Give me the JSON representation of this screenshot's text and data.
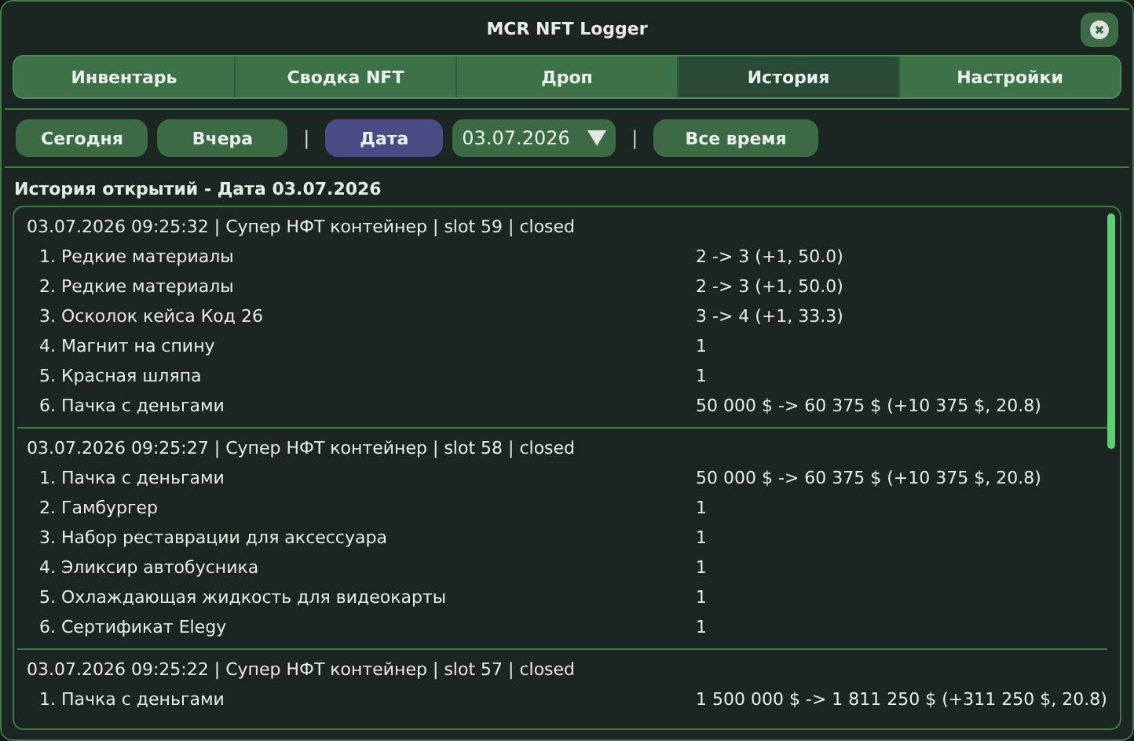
{
  "window": {
    "title": "MCR NFT Logger"
  },
  "tabs": [
    {
      "label": "Инвентарь",
      "selected": false
    },
    {
      "label": "Сводка NFT",
      "selected": false
    },
    {
      "label": "Дроп",
      "selected": false
    },
    {
      "label": "История",
      "selected": true
    },
    {
      "label": "Настройки",
      "selected": false
    }
  ],
  "filters": [
    {
      "kind": "button",
      "label": "Сегодня",
      "selected": false
    },
    {
      "kind": "button",
      "label": "Вчера",
      "selected": false
    },
    {
      "kind": "separator",
      "label": "|"
    },
    {
      "kind": "button",
      "label": "Дата",
      "selected": true
    },
    {
      "kind": "date",
      "value": "03.07.2026"
    },
    {
      "kind": "separator",
      "label": "|"
    },
    {
      "kind": "button",
      "label": "Все время",
      "selected": false
    }
  ],
  "history": {
    "heading": "История открытий - Дата 03.07.2026",
    "entries": [
      {
        "header": "03.07.2026 09:25:32 | Супер НФТ контейнер | slot 59 | closed",
        "items": [
          {
            "name": "1. Редкие материалы",
            "value": "2 -> 3 (+1, 50.0)"
          },
          {
            "name": "2. Редкие материалы",
            "value": "2 -> 3 (+1, 50.0)"
          },
          {
            "name": "3. Осколок кейса Код 26",
            "value": "3 -> 4 (+1, 33.3)"
          },
          {
            "name": "4. Магнит на спину",
            "value": "1"
          },
          {
            "name": "5. Красная шляпа",
            "value": "1"
          },
          {
            "name": "6. Пачка с деньгами",
            "value": "50 000 $ -> 60 375 $ (+10 375 $, 20.8)"
          }
        ]
      },
      {
        "header": "03.07.2026 09:25:27 | Супер НФТ контейнер | slot 58 | closed",
        "items": [
          {
            "name": "1. Пачка с деньгами",
            "value": "50 000 $ -> 60 375 $ (+10 375 $, 20.8)"
          },
          {
            "name": "2. Гамбургер",
            "value": "1"
          },
          {
            "name": "3. Набор реставрации для аксессуара",
            "value": "1"
          },
          {
            "name": "4. Эликсир автобусника",
            "value": "1"
          },
          {
            "name": "5. Охлаждающая жидкость для видеокарты",
            "value": "1"
          },
          {
            "name": "6. Сертификат Elegy",
            "value": "1"
          }
        ]
      },
      {
        "header": "03.07.2026 09:25:22 | Супер НФТ контейнер | slot 57 | closed",
        "items": [
          {
            "name": "1. Пачка с деньгами",
            "value": "1 500 000 $ -> 1 811 250 $ (+311 250 $, 20.8)"
          }
        ]
      }
    ]
  }
}
